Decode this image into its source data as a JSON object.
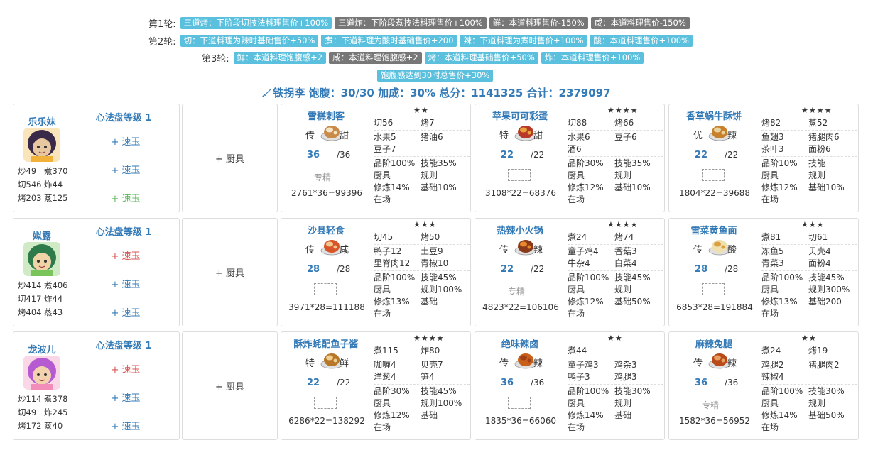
{
  "rules": [
    {
      "label": "第1轮:",
      "tags": [
        {
          "text": "三道烤：下阶段切技法料理售价+100%",
          "color": "blue"
        },
        {
          "text": "三道炸：下阶段煮技法料理售价+100%",
          "color": "gray"
        },
        {
          "text": "鲜：本道料理售价-150%",
          "color": "gray"
        },
        {
          "text": "咸：本道料理售价-150%",
          "color": "gray"
        }
      ]
    },
    {
      "label": "第2轮:",
      "tags": [
        {
          "text": "切：下道料理为辣时基础售价+50%",
          "color": "blue"
        },
        {
          "text": "煮：下道料理为酸时基础售价+200",
          "color": "blue"
        },
        {
          "text": "辣：下道料理为煮时售价+100%",
          "color": "blue"
        },
        {
          "text": "酸：本道料理售价+100%",
          "color": "blue"
        }
      ]
    },
    {
      "label": "第3轮:",
      "tags": [
        {
          "text": "鲜：本道料理饱腹感+2",
          "color": "blue"
        },
        {
          "text": "咸：本道料理饱腹感+2",
          "color": "gray"
        },
        {
          "text": "烤：本道料理基础售价+50%",
          "color": "blue"
        },
        {
          "text": "炸：本道料理售价+100%",
          "color": "blue"
        }
      ]
    },
    {
      "label": "",
      "tags": [
        {
          "text": "饱腹感达到30时总售价+30%",
          "color": "blue"
        }
      ]
    }
  ],
  "summary": "铁拐李 饱腹：30/30 加成：30% 总分：1141325 合计：2379097",
  "summary_icon": "sword-icon",
  "rows": [
    {
      "chef": {
        "name": "乐乐妹",
        "avatar_icon": "chef-avatar-lelemei",
        "level": "心法盘等级 1",
        "equips": [
          {
            "text": "+ 速玉",
            "color": "blue"
          },
          {
            "text": "+ 速玉",
            "color": "blue"
          },
          {
            "text": "+ 速玉",
            "color": "green"
          }
        ],
        "stats": [
          [
            "炒49",
            "煮370"
          ],
          [
            "切546",
            "炸44"
          ],
          [
            "烤203",
            "蒸125"
          ]
        ]
      },
      "tool": "+ 厨具",
      "recipes": [
        {
          "name": "雪糕刺客",
          "stars": "★★",
          "rarity": "传",
          "taste": "甜",
          "image_icon": "ice-cream-dish-icon",
          "qty": "36",
          "qtymax": "/36",
          "special": "专精",
          "broken": false,
          "formula": "2761*36=99396",
          "skills": [
            [
              "切56",
              "烤7"
            ]
          ],
          "ingredients": [
            [
              "水果5",
              "猪油6"
            ],
            [
              "豆子7",
              ""
            ]
          ],
          "bonus": [
            [
              "品阶100%",
              "技能35%"
            ],
            [
              "厨具",
              "规则"
            ],
            [
              "修炼14%",
              "基础10%"
            ],
            [
              "在场",
              ""
            ]
          ]
        },
        {
          "name": "苹果可可彩蛋",
          "stars": "★★★★",
          "rarity": "特",
          "taste": "甜",
          "image_icon": "apple-cocoa-egg-icon",
          "qty": "22",
          "qtymax": "/22",
          "special": "",
          "broken": true,
          "formula": "3108*22=68376",
          "skills": [
            [
              "切88",
              "烤66"
            ]
          ],
          "ingredients": [
            [
              "水果6",
              "豆子6"
            ],
            [
              "酒6",
              ""
            ]
          ],
          "bonus": [
            [
              "品阶30%",
              "技能35%"
            ],
            [
              "厨具",
              "规则"
            ],
            [
              "修炼12%",
              "基础10%"
            ],
            [
              "在场",
              ""
            ]
          ]
        },
        {
          "name": "香草蜗牛酥饼",
          "stars": "★★★★",
          "rarity": "优",
          "taste": "辣",
          "image_icon": "snail-pastry-icon",
          "qty": "22",
          "qtymax": "/22",
          "special": "",
          "broken": true,
          "formula": "1804*22=39688",
          "skills": [
            [
              "烤82",
              "蒸52"
            ]
          ],
          "ingredients": [
            [
              "鱼翅3",
              "猪腿肉6"
            ],
            [
              "茶叶3",
              "面粉6"
            ]
          ],
          "bonus": [
            [
              "品阶10%",
              "技能"
            ],
            [
              "厨具",
              "规则"
            ],
            [
              "修炼12%",
              "基础10%"
            ],
            [
              "在场",
              ""
            ]
          ]
        }
      ]
    },
    {
      "chef": {
        "name": "姒露",
        "avatar_icon": "chef-avatar-silu",
        "level": "心法盘等级 1",
        "equips": [
          {
            "text": "+ 速玉",
            "color": "red"
          },
          {
            "text": "+ 速玉",
            "color": "blue"
          },
          {
            "text": "+ 速玉",
            "color": "blue"
          }
        ],
        "stats": [
          [
            "炒414",
            "煮406"
          ],
          [
            "切417",
            "炸44"
          ],
          [
            "烤404",
            "蒸43"
          ]
        ]
      },
      "tool": "+ 厨具",
      "recipes": [
        {
          "name": "沙县轻食",
          "stars": "★★★",
          "rarity": "传",
          "taste": "咸",
          "image_icon": "light-meal-icon",
          "qty": "28",
          "qtymax": "/28",
          "special": "",
          "broken": true,
          "formula": "3971*28=111188",
          "skills": [
            [
              "切45",
              "烤50"
            ]
          ],
          "ingredients": [
            [
              "鸭子12",
              "土豆9"
            ],
            [
              "里脊肉12",
              "青椒10"
            ]
          ],
          "bonus": [
            [
              "品阶100%",
              "技能45%"
            ],
            [
              "厨具",
              "规则100%"
            ],
            [
              "修炼13%",
              "基础"
            ],
            [
              "在场",
              ""
            ]
          ]
        },
        {
          "name": "热辣小火锅",
          "stars": "★★★★",
          "rarity": "传",
          "taste": "辣",
          "image_icon": "hot-pot-icon",
          "qty": "22",
          "qtymax": "/22",
          "special": "专精",
          "broken": false,
          "formula": "4823*22=106106",
          "skills": [
            [
              "煮24",
              "烤74"
            ]
          ],
          "ingredients": [
            [
              "童子鸡4",
              "香菇3"
            ],
            [
              "牛杂4",
              "白菜4"
            ]
          ],
          "bonus": [
            [
              "品阶100%",
              "技能45%"
            ],
            [
              "厨具",
              "规则"
            ],
            [
              "修炼12%",
              "基础50%"
            ],
            [
              "在场",
              ""
            ]
          ]
        },
        {
          "name": "雪菜黄鱼面",
          "stars": "★★★",
          "rarity": "传",
          "taste": "酸",
          "image_icon": "fish-noodle-icon",
          "qty": "28",
          "qtymax": "/28",
          "special": "",
          "broken": true,
          "formula": "6853*28=191884",
          "skills": [
            [
              "煮81",
              "切61"
            ]
          ],
          "ingredients": [
            [
              "冻鱼5",
              "贝壳4"
            ],
            [
              "青菜3",
              "面粉4"
            ]
          ],
          "bonus": [
            [
              "品阶100%",
              "技能45%"
            ],
            [
              "厨具",
              "规则300%"
            ],
            [
              "修炼13%",
              "基础200"
            ],
            [
              "在场",
              ""
            ]
          ]
        }
      ]
    },
    {
      "chef": {
        "name": "龙波儿",
        "avatar_icon": "chef-avatar-longboer",
        "level": "心法盘等级 1",
        "equips": [
          {
            "text": "+ 速玉",
            "color": "red"
          },
          {
            "text": "+ 速玉",
            "color": "blue"
          },
          {
            "text": "+ 速玉",
            "color": "blue"
          }
        ],
        "stats": [
          [
            "炒114",
            "煮378"
          ],
          [
            "切49",
            "炸245"
          ],
          [
            "烤172",
            "蒸40"
          ]
        ]
      },
      "tool": "+ 厨具",
      "recipes": [
        {
          "name": "酥炸蚝配鱼子酱",
          "stars": "★★★★",
          "rarity": "特",
          "taste": "鲜",
          "image_icon": "fried-oyster-icon",
          "qty": "22",
          "qtymax": "/22",
          "special": "",
          "broken": true,
          "formula": "6286*22=138292",
          "skills": [
            [
              "煮115",
              "炸80"
            ]
          ],
          "ingredients": [
            [
              "咖喱4",
              "贝壳7"
            ],
            [
              "洋葱4",
              "笋4"
            ]
          ],
          "bonus": [
            [
              "品阶30%",
              "技能45%"
            ],
            [
              "厨具",
              "规则100%"
            ],
            [
              "修炼12%",
              "基础"
            ],
            [
              "在场",
              ""
            ]
          ]
        },
        {
          "name": "绝味辣卤",
          "stars": "★★",
          "rarity": "传",
          "taste": "辣",
          "image_icon": "spicy-braise-icon",
          "qty": "36",
          "qtymax": "/36",
          "special": "",
          "broken": true,
          "formula": "1835*36=66060",
          "skills": [
            [
              "煮44",
              ""
            ]
          ],
          "ingredients": [
            [
              "童子鸡3",
              "鸡杂3"
            ],
            [
              "鸭子3",
              "鸡腿3"
            ]
          ],
          "bonus": [
            [
              "品阶100%",
              "技能30%"
            ],
            [
              "厨具",
              "规则"
            ],
            [
              "修炼14%",
              "基础"
            ],
            [
              "在场",
              ""
            ]
          ]
        },
        {
          "name": "麻辣兔腿",
          "stars": "★★",
          "rarity": "传",
          "taste": "辣",
          "image_icon": "rabbit-leg-icon",
          "qty": "36",
          "qtymax": "/36",
          "special": "专精",
          "broken": false,
          "formula": "1582*36=56952",
          "skills": [
            [
              "煮24",
              "烤19"
            ]
          ],
          "ingredients": [
            [
              "鸡腿2",
              "猪腿肉2"
            ],
            [
              "辣椒4",
              ""
            ]
          ],
          "bonus": [
            [
              "品阶100%",
              "技能30%"
            ],
            [
              "厨具",
              "规则"
            ],
            [
              "修炼14%",
              "基础50%"
            ],
            [
              "在场",
              ""
            ]
          ]
        }
      ]
    }
  ],
  "colors": {
    "tag_blue": "#5bc0de",
    "tag_gray": "#777777",
    "link_blue": "#337ab7",
    "red": "#d9534f",
    "green": "#5cb85c"
  }
}
